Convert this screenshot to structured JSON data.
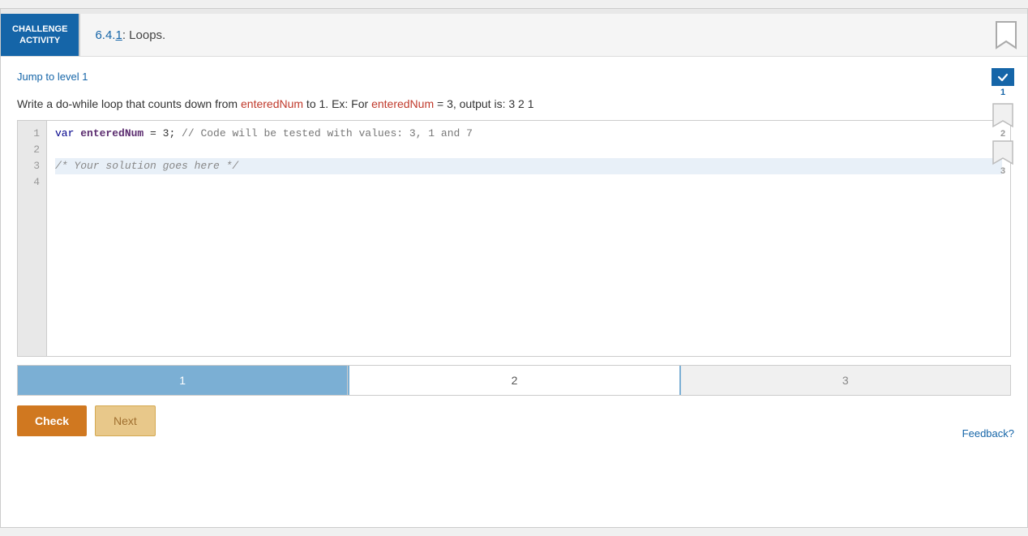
{
  "header": {
    "challenge_label": "CHALLENGE\nACTIVITY",
    "challenge_title_prefix": "6.4.",
    "challenge_title_link": "1",
    "challenge_title_suffix": ": Loops."
  },
  "jump_link": "Jump to level 1",
  "instruction": {
    "text_before": "Write a do-while loop that counts down from ",
    "highlight1": "enteredNum",
    "text_middle": " to 1. Ex: For ",
    "highlight2": "enteredNum",
    "text_end": " = 3, output is: 3 2 1"
  },
  "code_editor": {
    "lines": [
      {
        "number": "1",
        "content": "var enteredNum = 3; // Code will be tested with values: 3, 1 and 7",
        "active": false
      },
      {
        "number": "2",
        "content": "",
        "active": false
      },
      {
        "number": "3",
        "content": "/* Your solution goes here */",
        "active": true
      },
      {
        "number": "4",
        "content": "",
        "active": false
      }
    ]
  },
  "step_tabs": [
    {
      "label": "1",
      "state": "active"
    },
    {
      "label": "2",
      "state": "current"
    },
    {
      "label": "3",
      "state": "inactive"
    }
  ],
  "buttons": {
    "check_label": "Check",
    "next_label": "Next"
  },
  "level_badges": [
    {
      "number": "1",
      "state": "checked"
    },
    {
      "number": "2",
      "state": "inactive"
    },
    {
      "number": "3",
      "state": "inactive"
    }
  ],
  "feedback_label": "Feedback?"
}
